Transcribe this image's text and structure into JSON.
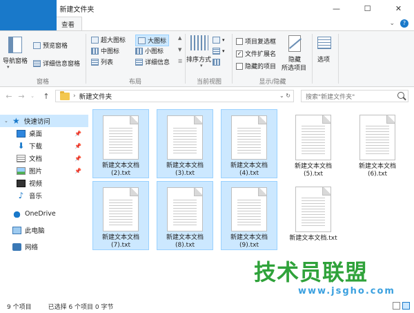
{
  "window": {
    "title": "新建文件夹",
    "controls": {
      "minimize": "—",
      "maximize": "☐",
      "close": "✕"
    }
  },
  "tabs": [
    {
      "label": "文件"
    },
    {
      "label": "主页"
    },
    {
      "label": "共享"
    },
    {
      "label": "查看"
    }
  ],
  "ribbon": {
    "panes": {
      "nav_pane": "导航窗格",
      "preview": "预览窗格",
      "details": "详细信息窗格",
      "label": "窗格"
    },
    "layout": {
      "xl_icons": "超大图标",
      "large_icons": "大图标",
      "medium_icons": "中图标",
      "small_icons": "小图标",
      "list": "列表",
      "details": "详细信息",
      "label": "布局"
    },
    "current_view": {
      "sort_by": "排序方式",
      "label": "当前视图"
    },
    "show_hide": {
      "item_checkboxes": "项目复选框",
      "item_checkboxes_checked": false,
      "file_ext": "文件扩展名",
      "file_ext_checked": true,
      "hidden_items": "隐藏的项目",
      "hidden_items_checked": false,
      "hide_selected_1": "隐藏",
      "hide_selected_2": "所选项目",
      "label": "显示/隐藏"
    },
    "options": "选项"
  },
  "address": {
    "path": "新建文件夹",
    "search_placeholder": "搜索\"新建文件夹\""
  },
  "nav": [
    {
      "label": "快速访问",
      "icon": "star-icon",
      "pinned": false,
      "selected": true
    },
    {
      "label": "桌面",
      "icon": "desktop-icon",
      "pinned": true
    },
    {
      "label": "下载",
      "icon": "download-icon",
      "pinned": true
    },
    {
      "label": "文档",
      "icon": "document-icon",
      "pinned": true
    },
    {
      "label": "图片",
      "icon": "picture-icon",
      "pinned": true
    },
    {
      "label": "视频",
      "icon": "video-icon",
      "pinned": false
    },
    {
      "label": "音乐",
      "icon": "music-icon",
      "pinned": false
    },
    {
      "label": "OneDrive",
      "icon": "cloud-icon",
      "pinned": false
    },
    {
      "label": "此电脑",
      "icon": "pc-icon",
      "pinned": false
    },
    {
      "label": "网络",
      "icon": "network-icon",
      "pinned": false
    }
  ],
  "files": [
    {
      "line1": "新建文本文档",
      "line2": "(2).txt",
      "selected": true
    },
    {
      "line1": "新建文本文档",
      "line2": "(3).txt",
      "selected": true
    },
    {
      "line1": "新建文本文档",
      "line2": "(4).txt",
      "selected": true
    },
    {
      "line1": "新建文本文档",
      "line2": "(5).txt",
      "selected": false
    },
    {
      "line1": "新建文本文档",
      "line2": "(6).txt",
      "selected": false
    },
    {
      "line1": "新建文本文档",
      "line2": "(7).txt",
      "selected": true
    },
    {
      "line1": "新建文本文档",
      "line2": "(8).txt",
      "selected": true
    },
    {
      "line1": "新建文本文档",
      "line2": "(9).txt",
      "selected": true
    },
    {
      "line1": "新建文本文档.txt",
      "line2": "",
      "selected": false
    }
  ],
  "status": {
    "count": "9 个项目",
    "selected": "已选择 6 个项目  0 字节"
  },
  "watermark": {
    "text": "技术员联盟",
    "url": "www.jsgho.com"
  },
  "colors": {
    "accent": "#1979ca",
    "selection": "#cce8ff",
    "watermark_green": "#2fa23a",
    "watermark_blue": "#3aa0df"
  }
}
